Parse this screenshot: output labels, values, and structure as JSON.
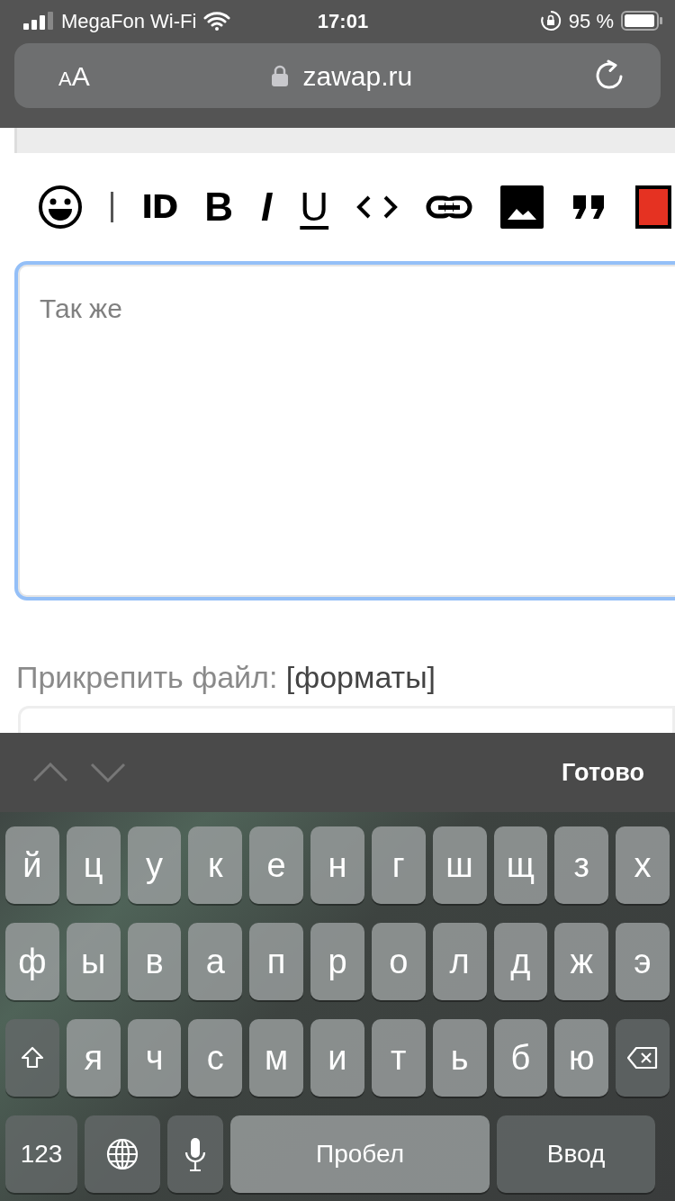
{
  "status_bar": {
    "carrier": "MegaFon Wi-Fi",
    "time": "17:01",
    "battery": "95 %"
  },
  "address_bar": {
    "text_size": "AA",
    "url": "zawap.ru"
  },
  "toolbar": [
    {
      "kind": "emoji"
    },
    {
      "kind": "separator"
    },
    {
      "kind": "id",
      "label": "ID"
    },
    {
      "kind": "bold",
      "label": "B"
    },
    {
      "kind": "italic",
      "label": "I"
    },
    {
      "kind": "underline",
      "label": "U"
    },
    {
      "kind": "code"
    },
    {
      "kind": "link"
    },
    {
      "kind": "image"
    },
    {
      "kind": "quote"
    },
    {
      "kind": "color",
      "color": "#e53222"
    }
  ],
  "editor": {
    "value": "Так же",
    "focused": true
  },
  "attach": {
    "label": "Прикрепить файл:",
    "link": "[форматы]"
  },
  "accessory_bar": {
    "done": "Готово"
  },
  "keyboard": [
    [
      {
        "kind": "letter",
        "label": "й"
      },
      {
        "kind": "letter",
        "label": "ц"
      },
      {
        "kind": "letter",
        "label": "у"
      },
      {
        "kind": "letter",
        "label": "к"
      },
      {
        "kind": "letter",
        "label": "е"
      },
      {
        "kind": "letter",
        "label": "н"
      },
      {
        "kind": "letter",
        "label": "г"
      },
      {
        "kind": "letter",
        "label": "ш"
      },
      {
        "kind": "letter",
        "label": "щ"
      },
      {
        "kind": "letter",
        "label": "з"
      },
      {
        "kind": "letter",
        "label": "х"
      }
    ],
    [
      {
        "kind": "letter",
        "label": "ф"
      },
      {
        "kind": "letter",
        "label": "ы"
      },
      {
        "kind": "letter",
        "label": "в"
      },
      {
        "kind": "letter",
        "label": "а"
      },
      {
        "kind": "letter",
        "label": "п"
      },
      {
        "kind": "letter",
        "label": "р"
      },
      {
        "kind": "letter",
        "label": "о"
      },
      {
        "kind": "letter",
        "label": "л"
      },
      {
        "kind": "letter",
        "label": "д"
      },
      {
        "kind": "letter",
        "label": "ж"
      },
      {
        "kind": "letter",
        "label": "э"
      }
    ],
    [
      {
        "kind": "shift"
      },
      {
        "kind": "letter",
        "label": "я"
      },
      {
        "kind": "letter",
        "label": "ч"
      },
      {
        "kind": "letter",
        "label": "с"
      },
      {
        "kind": "letter",
        "label": "м"
      },
      {
        "kind": "letter",
        "label": "и"
      },
      {
        "kind": "letter",
        "label": "т"
      },
      {
        "kind": "letter",
        "label": "ь"
      },
      {
        "kind": "letter",
        "label": "б"
      },
      {
        "kind": "letter",
        "label": "ю"
      },
      {
        "kind": "backspace"
      }
    ],
    [
      {
        "kind": "numbers",
        "label": "123"
      },
      {
        "kind": "globe"
      },
      {
        "kind": "mic"
      },
      {
        "kind": "space",
        "label": "Пробел"
      },
      {
        "kind": "return",
        "label": "Ввод"
      }
    ]
  ]
}
